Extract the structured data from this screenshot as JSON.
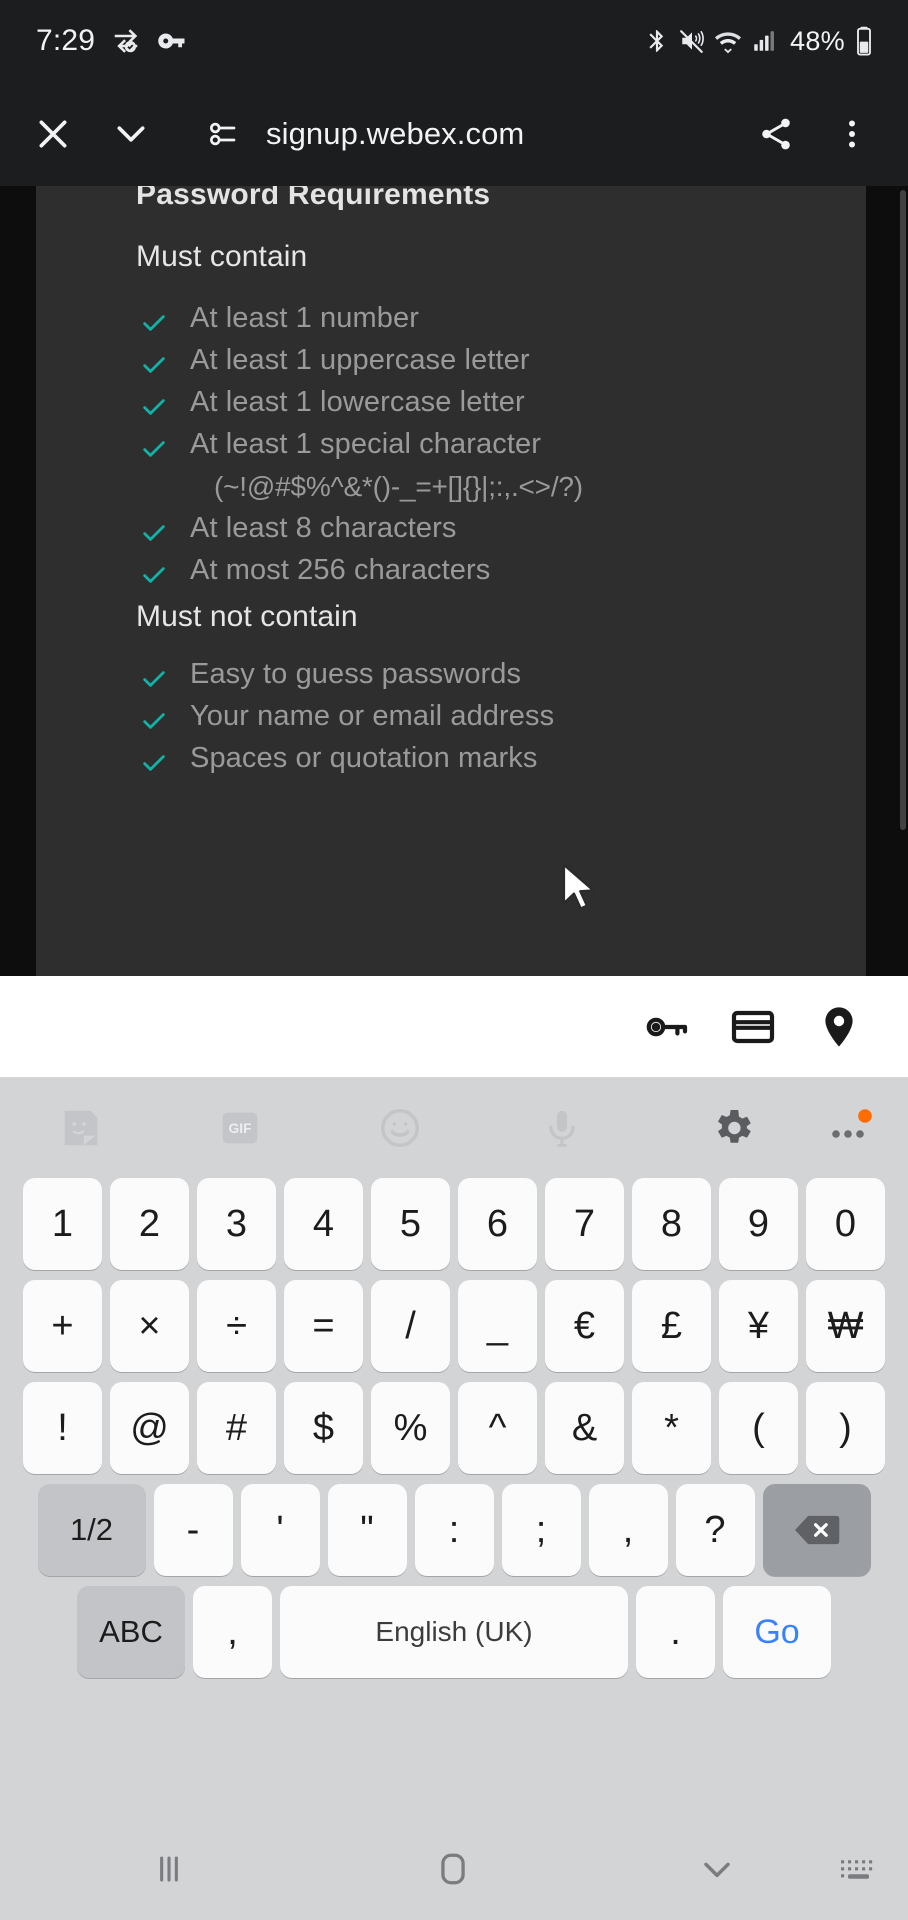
{
  "status_bar": {
    "time": "7:29",
    "battery_percent": "48%",
    "icons": [
      "data-saver-icon",
      "vpn-key-icon",
      "bluetooth-icon",
      "mute-vibrate-icon",
      "wifi-icon",
      "cell-signal-icon",
      "battery-icon"
    ]
  },
  "browser": {
    "url": "signup.webex.com",
    "close_label": "close-icon",
    "chevron_label": "chevron-down-icon",
    "site_info_label": "page-info-icon",
    "share_label": "share-icon",
    "menu_label": "overflow-menu-icon"
  },
  "page": {
    "title": "Password Requirements",
    "must_contain_heading": "Must contain",
    "must_contain": [
      "At least 1 number",
      "At least 1 uppercase letter",
      "At least 1 lowercase letter",
      "At least 1 special character"
    ],
    "special_characters": "(~!@#$%^&*()-_=+[]{}|;:,.<>/?)",
    "must_contain_tail": [
      "At least 8 characters",
      "At most 256 characters"
    ],
    "must_not_contain_heading": "Must not contain",
    "must_not_contain": [
      "Easy to guess passwords",
      "Your name or email address",
      "Spaces or quotation marks"
    ],
    "check_color": "#12b2a6",
    "card_color": "#2e2e2e",
    "text_color": "#9a9a9a"
  },
  "autofill_bar": {
    "items": [
      "password-key-icon",
      "credit-card-icon",
      "location-pin-icon"
    ]
  },
  "keyboard": {
    "toolbar": [
      "sticker-icon",
      "gif-icon",
      "emoji-icon",
      "microphone-icon",
      "settings-gear-icon",
      "more-options-icon"
    ],
    "badge_color": "#ff6d00",
    "rows": [
      [
        "1",
        "2",
        "3",
        "4",
        "5",
        "6",
        "7",
        "8",
        "9",
        "0"
      ],
      [
        "+",
        "×",
        "÷",
        "=",
        "/",
        "_",
        "€",
        "£",
        "¥",
        "₩"
      ],
      [
        "!",
        "@",
        "#",
        "$",
        "%",
        "^",
        "&",
        "*",
        "(",
        ")"
      ],
      [
        "1/2",
        "-",
        "'",
        "\"",
        ":",
        ";",
        ",",
        "?",
        "backspace-icon"
      ]
    ],
    "bottom_row": {
      "abc": "ABC",
      "comma": ",",
      "space": "English (UK)",
      "period": ".",
      "go": "Go"
    },
    "go_color": "#3b82f6"
  },
  "nav_bar": {
    "items": [
      "recents-icon",
      "home-icon",
      "back-down-icon",
      "keyboard-switch-icon"
    ]
  }
}
